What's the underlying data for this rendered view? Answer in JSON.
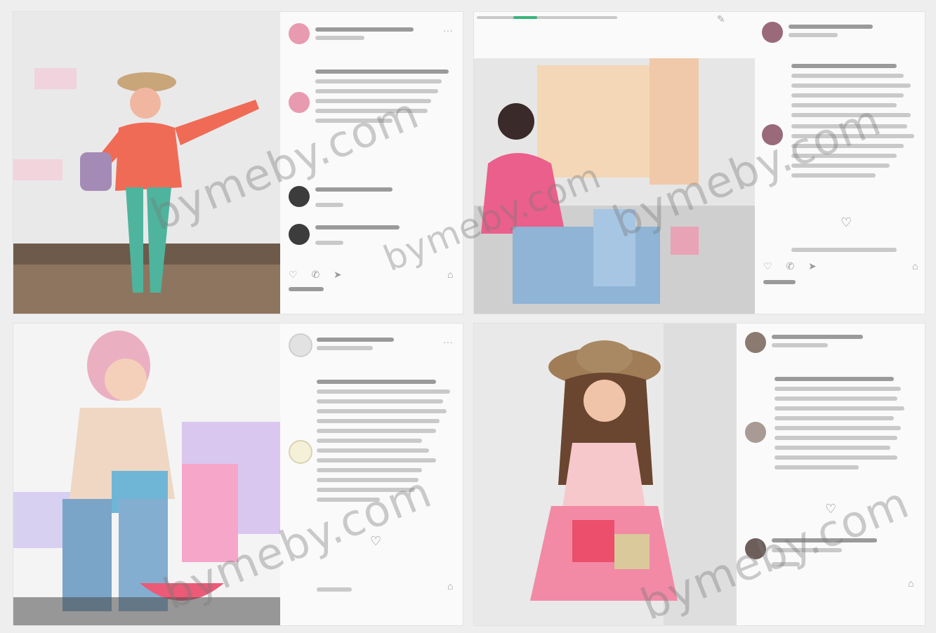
{
  "watermarks": [
    "bymeby.com",
    "bymeby.com",
    "bymeby.com",
    "bymeby.com",
    "bymeby.com"
  ],
  "icons": {
    "heart": "♡",
    "actions": "♡ ✆ ➤",
    "bookmark": "⌂",
    "more": "···"
  },
  "colors": {
    "page_bg": "#eeeeee",
    "post_bg": "#fafafa",
    "avatar_pink": "#e79ab0",
    "avatar_dark": "#3c3c3c"
  }
}
